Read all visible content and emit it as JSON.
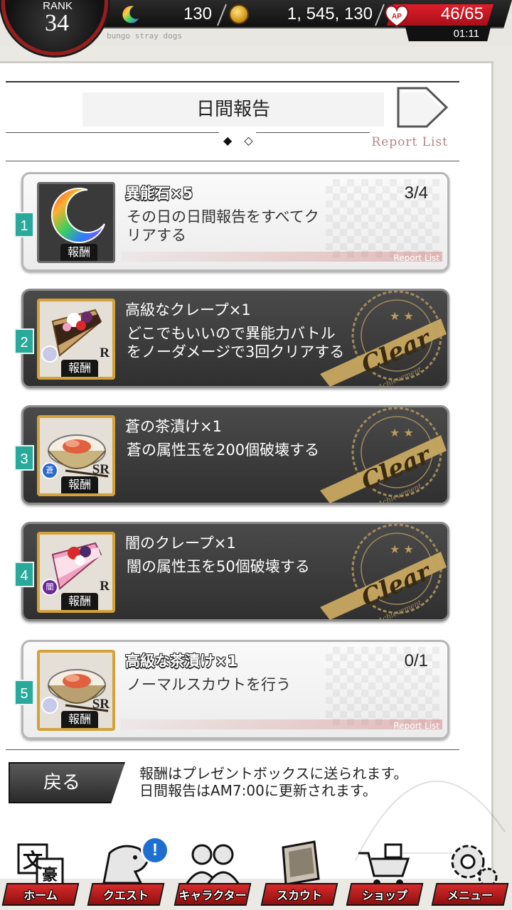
{
  "status_bar": {
    "rank_label": "RANK",
    "rank_value": "34",
    "stone_count": "130",
    "coin_count": "1, 545, 130",
    "stamina": "46/65",
    "stamina_timer": "01:11",
    "brand": "bungo stray dogs",
    "stamina_color": "#d81b26"
  },
  "header": {
    "title": "日間報告",
    "page_indicator": "◆ ◇",
    "report_list_link": "Report List"
  },
  "reports": [
    {
      "index": "1",
      "reward": "異能石×5",
      "mission": "その日の日間報告をすべてク\nリアする",
      "progress": "3/4",
      "reward_tag": "報酬",
      "report_list": "Report List",
      "state": "active",
      "icon": "rainbow-moon-icon"
    },
    {
      "index": "2",
      "reward": "高級なクレープ×1",
      "mission": "どこでもいいので異能力バトル\nをノーダメージで3回クリアする",
      "reward_tag": "報酬",
      "rarity": "R",
      "state": "cleared",
      "icon": "crepe-icon"
    },
    {
      "index": "3",
      "reward": "蒼の茶漬け×1",
      "mission": "蒼の属性玉を200個破壊する",
      "reward_tag": "報酬",
      "rarity": "SR",
      "attribute": "蒼",
      "state": "cleared",
      "icon": "ochazuke-icon"
    },
    {
      "index": "4",
      "reward": "闇のクレープ×1",
      "mission": "闇の属性玉を50個破壊する",
      "reward_tag": "報酬",
      "rarity": "R",
      "attribute": "闇",
      "state": "cleared",
      "icon": "crepe-icon"
    },
    {
      "index": "5",
      "reward": "高級な茶漬け×1",
      "mission": "ノーマルスカウトを行う",
      "progress": "0/1",
      "reward_tag": "報酬",
      "report_list": "Report List",
      "rarity": "SR",
      "state": "active",
      "icon": "ochazuke-icon"
    }
  ],
  "clear_stamp": {
    "text": "Clear",
    "subtext": "Achievement"
  },
  "footer": {
    "back_label": "戻る",
    "note_line1": "報酬はプレゼントボックスに送られます。",
    "note_line2": "日間報告はAM7:00に更新されます。"
  },
  "bottom_nav": [
    {
      "label": "ホーム",
      "icon": "bungo-emblem-icon"
    },
    {
      "label": "クエスト",
      "icon": "quest-dog-icon"
    },
    {
      "label": "キャラクター",
      "icon": "characters-icon"
    },
    {
      "label": "スカウト",
      "icon": "scout-book-icon"
    },
    {
      "label": "ショップ",
      "icon": "shop-cart-icon"
    },
    {
      "label": "メニュー",
      "icon": "gear-icon"
    }
  ],
  "notification_badge": "!"
}
